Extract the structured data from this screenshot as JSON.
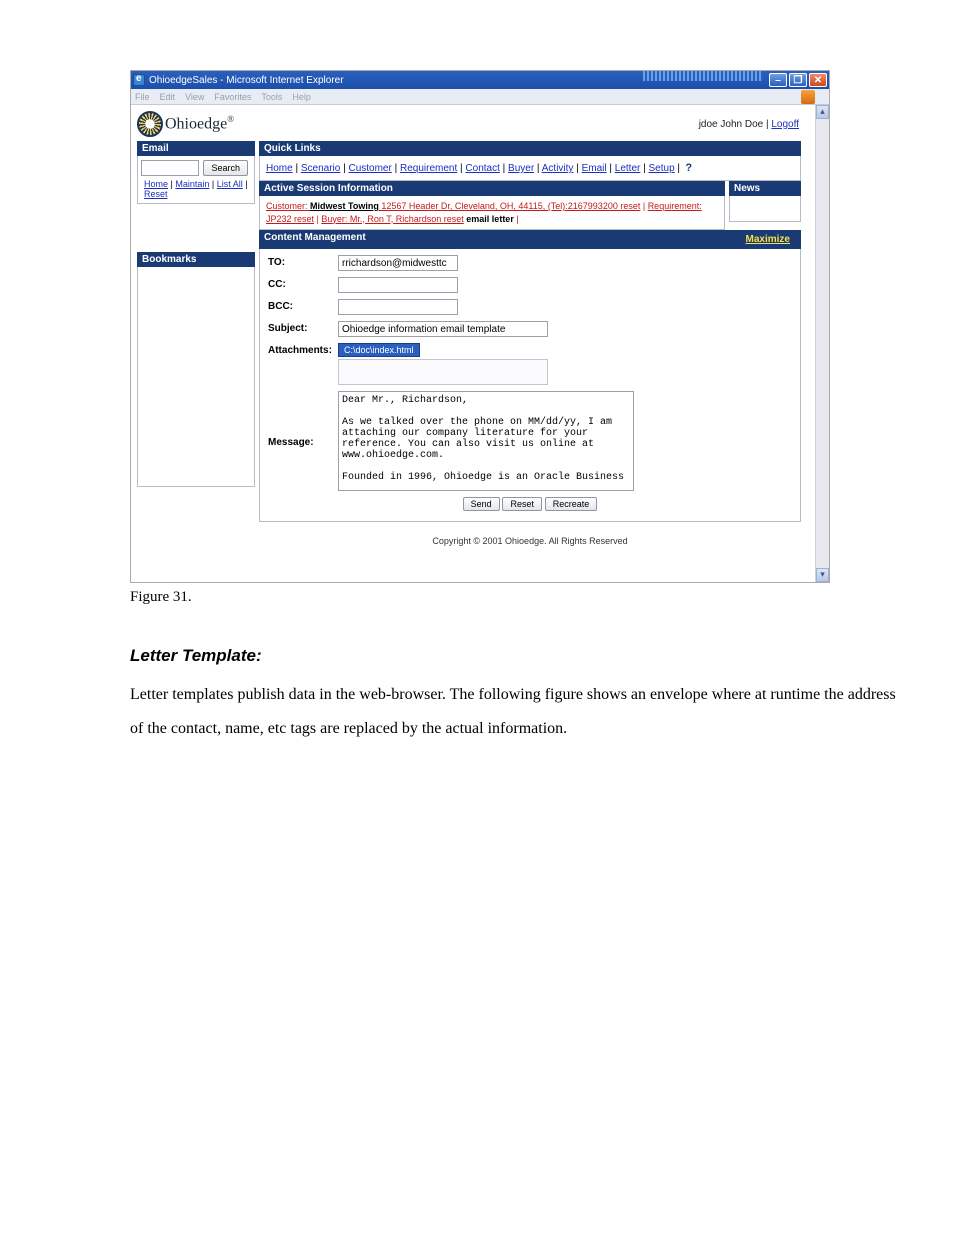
{
  "window": {
    "title": "OhioedgeSales - Microsoft Internet Explorer",
    "menus": [
      "File",
      "Edit",
      "View",
      "Favorites",
      "Tools",
      "Help"
    ]
  },
  "header": {
    "brand": "Ohioedge",
    "brand_tm": "®",
    "user": "jdoe John Doe",
    "logoff": "Logoff"
  },
  "left": {
    "email_h": "Email",
    "search_btn": "Search",
    "links": {
      "home": "Home",
      "maintain": "Maintain",
      "list_all": "List All",
      "reset": "Reset"
    },
    "bookmarks_h": "Bookmarks"
  },
  "quicklinks": {
    "title": "Quick Links",
    "items": [
      "Home",
      "Scenario",
      "Customer",
      "Requirement",
      "Contact",
      "Buyer",
      "Activity",
      "Email",
      "Letter",
      "Setup"
    ]
  },
  "session": {
    "title": "Active Session Information",
    "customer_lbl": "Customer: ",
    "customer_name": "Midwest Towing",
    "customer_rest": " 12567 Header Dr, Cleveland, OH, 44115, (Tel):2167993200 reset",
    "req_lbl": "Requirement: ",
    "req_rest": "JP232 reset",
    "buyer_lbl": "Buyer: ",
    "buyer_rest": "Mr., Ron T, Richardson reset",
    "trail": " email letter"
  },
  "news_h": "News",
  "cm": {
    "title": "Content Management",
    "maximize": "Maximize",
    "labels": {
      "to": "TO:",
      "cc": "CC:",
      "bcc": "BCC:",
      "subject": "Subject:",
      "attachments": "Attachments:",
      "message": "Message:"
    },
    "to_val": "rrichardson@midwesttc",
    "subject_val": "Ohioedge information email template",
    "file": "C:\\doc\\index.html",
    "msg": "Dear Mr., Richardson,\n\nAs we talked over the phone on MM/dd/yy, I am attaching our company literature for your reference. You can also visit us online at www.ohioedge.com.\n\nFounded in 1996, Ohioedge is an Oracle Business",
    "buttons": {
      "send": "Send",
      "reset": "Reset",
      "recreate": "Recreate"
    }
  },
  "copyright": "Copyright © 2001 Ohioedge. All Rights Reserved",
  "caption": "Figure 31.",
  "doc": {
    "section": "Letter Template:",
    "para": "Letter templates publish data in the web-browser. The following figure shows an envelope where at runtime the address of the contact, name, etc tags are replaced by the actual information."
  }
}
